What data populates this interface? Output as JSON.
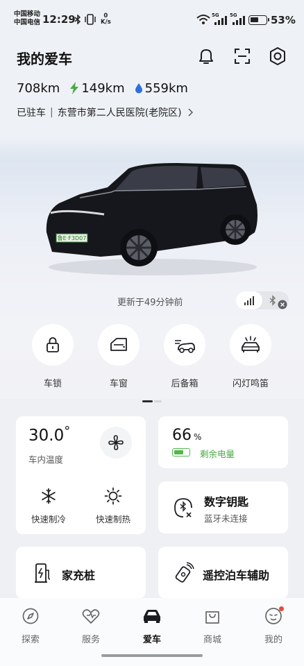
{
  "status_bar": {
    "carrier_1": "中国移动",
    "carrier_2": "中国电信",
    "time": "12:29",
    "speed_value": "0",
    "speed_unit": "K/s",
    "net_1": "5G",
    "net_2": "5G",
    "battery_pct": "53%",
    "battery_level": 0.53
  },
  "header": {
    "title": "我的爱车",
    "icons": [
      "bell-icon",
      "scan-icon",
      "settings-icon"
    ]
  },
  "range": {
    "total": "708km",
    "electric": "149km",
    "fuel": "559km"
  },
  "parking": {
    "status": "已驻车",
    "separator": "|",
    "location": "东营市第二人民医院(老院区)"
  },
  "car": {
    "plate": "鲁E·F3D07",
    "updated_text": "更新于49分钟前"
  },
  "quick_actions": [
    {
      "label": "车锁",
      "icon": "lock-icon"
    },
    {
      "label": "车窗",
      "icon": "window-icon"
    },
    {
      "label": "后备箱",
      "icon": "trunk-icon"
    },
    {
      "label": "闪灯鸣笛",
      "icon": "flash-horn-icon"
    }
  ],
  "climate": {
    "temperature": "30.0",
    "degree": "°",
    "temp_label": "车内温度",
    "cool_label": "快速制冷",
    "heat_label": "快速制热"
  },
  "battery": {
    "value": "66",
    "unit": "%",
    "label": "剩余电量",
    "level": 0.66
  },
  "digital_key": {
    "title": "数字钥匙",
    "subtitle": "蓝牙未连接"
  },
  "charger": {
    "label": "家充桩"
  },
  "remote_parking": {
    "label": "遥控泊车辅助"
  },
  "colors": {
    "accent_green": "#4aa844",
    "fuel_blue": "#2e6fe0",
    "notification_red": "#e8493a"
  },
  "tabs": [
    {
      "label": "探索",
      "icon": "explore-icon",
      "active": false
    },
    {
      "label": "服务",
      "icon": "service-icon",
      "active": false
    },
    {
      "label": "爱车",
      "icon": "car-icon",
      "active": true
    },
    {
      "label": "商城",
      "icon": "shop-icon",
      "active": false
    },
    {
      "label": "我的",
      "icon": "profile-icon",
      "active": false
    }
  ]
}
